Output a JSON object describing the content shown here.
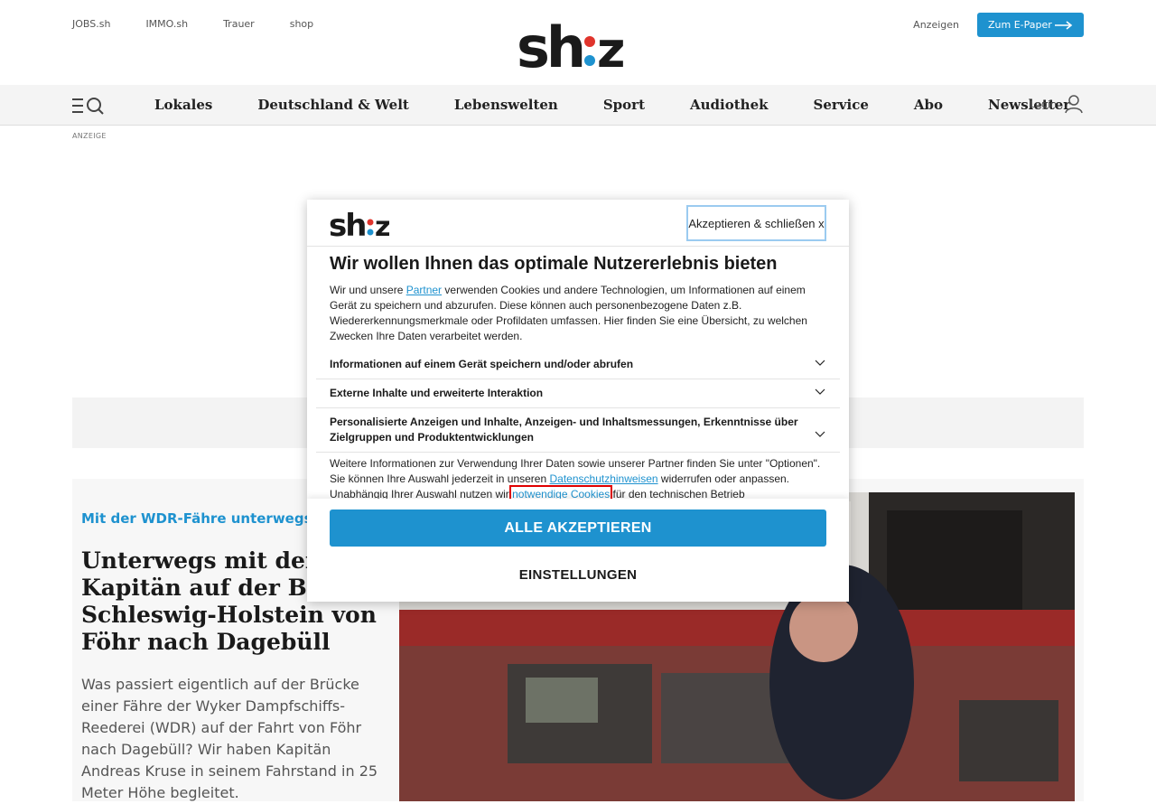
{
  "header": {
    "top_links": [
      "JOBS.sh",
      "IMMO.sh",
      "Trauer",
      "shop"
    ],
    "logo_text": "sh:z",
    "anzeigen_label": "Anzeigen",
    "epaper_label": "Zum E-Paper"
  },
  "nav": {
    "items": [
      "Lokales",
      "Deutschland & Welt",
      "Lebenswelten",
      "Sport",
      "Audiothek",
      "Service",
      "Abo",
      "Newsletter"
    ],
    "login_label": "Login"
  },
  "ad_label": "ANZEIGE",
  "article": {
    "kicker": "Mit der WDR-Fähre unterwegs",
    "headline": "Unterwegs mit dem Kapitän auf der Brücke: Schleswig-Holstein von Föhr nach Dagebüll",
    "teaser": "Was passiert eigentlich auf der Brücke einer Fähre der Wyker Dampfschiffs-Reederei (WDR) auf der Fahrt von Föhr nach Dagebüll? Wir haben Kapitän Andreas Kruse in seinem Fahrstand in 25 Meter Höhe begleitet."
  },
  "consent": {
    "logo_text": "sh:z",
    "accept_close_label": "Akzeptieren & schließen x",
    "title": "Wir wollen Ihnen das optimale Nutzererlebnis bieten",
    "intro_before": "Wir und unsere ",
    "intro_link": "Partner",
    "intro_after": " verwenden Cookies und andere Technologien, um Informationen auf einem Gerät zu speichern und abzurufen. Diese können auch personenbezogene Daten z.B. Wiedererkennungsmerkmale oder Profildaten umfassen. Hier finden Sie eine Übersicht, zu welchen Zwecken Ihre Daten verarbeitet werden.",
    "purposes": [
      "Informationen auf einem Gerät speichern und/oder abrufen",
      "Externe Inhalte und erweiterte Interaktion",
      "Personalisierte Anzeigen und Inhalte, Anzeigen- und Inhaltsmessungen, Erkenntnisse über Zielgruppen und Produktentwicklungen"
    ],
    "more_part1": "Weitere Informationen zur Verwendung Ihrer Daten sowie unserer Partner finden Sie unter \"Optionen\". Sie können Ihre Auswahl jederzeit in unseren ",
    "more_link1": "Datenschutzhinweisen",
    "more_part2": " widerrufen oder anpassen. Unabhängig Ihrer Auswahl nutzen wir ",
    "more_link2": "notwendige Cookies",
    "more_part3": " für den technischen Betrieb",
    "accept_all_label": "ALLE AKZEPTIEREN",
    "settings_label": "EINSTELLUNGEN"
  },
  "colors": {
    "accent": "#1e92cf",
    "logo_dot_red": "#e0342c",
    "logo_dot_blue": "#1e92cf",
    "highlight_red": "#e00000"
  }
}
